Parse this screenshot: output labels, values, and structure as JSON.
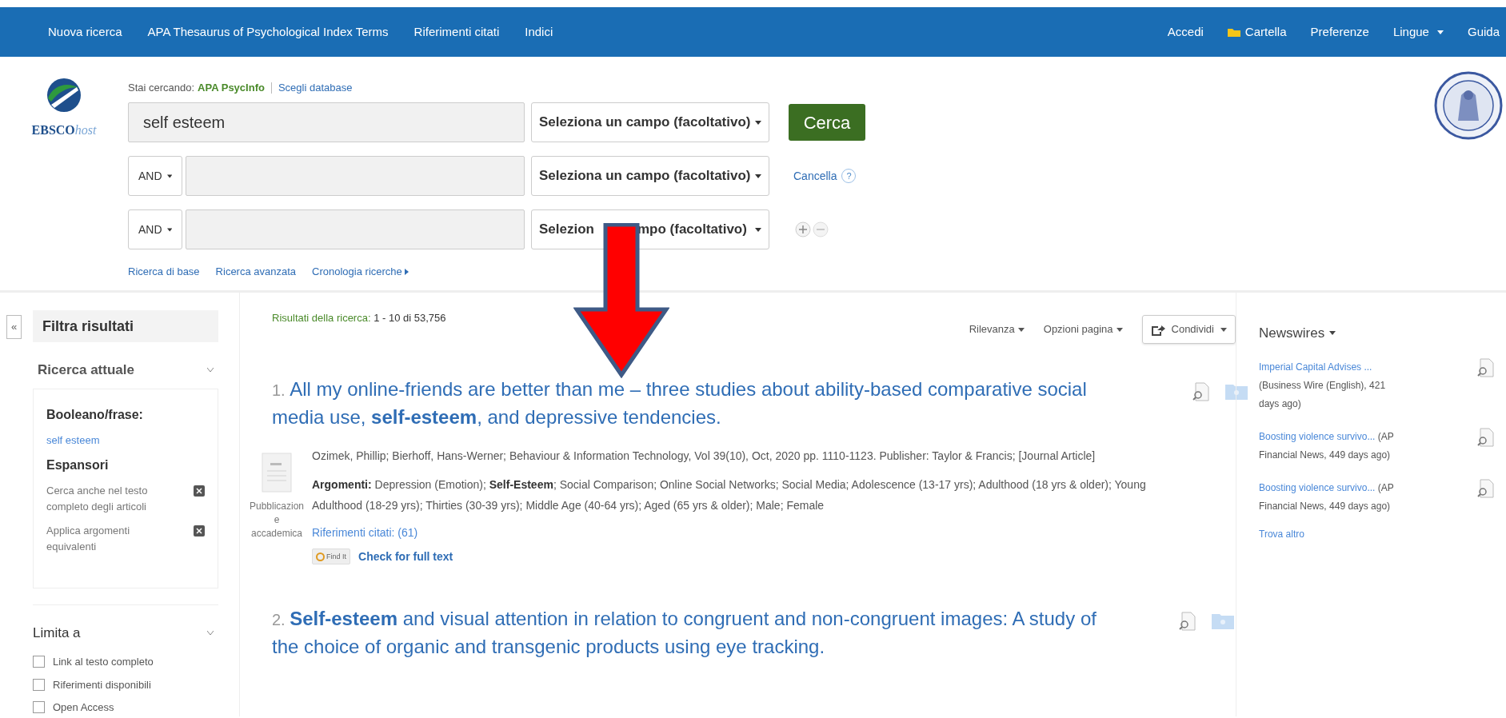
{
  "nav": {
    "left": [
      {
        "label": "Nuova ricerca",
        "kind": "link"
      },
      {
        "label": "APA Thesaurus of Psychological Index Terms",
        "kind": "link"
      },
      {
        "label": "Riferimenti citati",
        "kind": "link"
      },
      {
        "label": "Indici",
        "kind": "link"
      }
    ],
    "right": [
      {
        "label": "Accedi",
        "kind": "link"
      },
      {
        "label": "Cartella",
        "kind": "folder"
      },
      {
        "label": "Preferenze",
        "kind": "link"
      },
      {
        "label": "Lingue",
        "kind": "dropdown"
      },
      {
        "label": "Guida",
        "kind": "link"
      }
    ]
  },
  "logo": {
    "brand": "EBSCO",
    "suffix": "host"
  },
  "search": {
    "searching_label": "Stai cercando:",
    "database": "APA PsycInfo",
    "choose_database": "Scegli database",
    "rows": [
      {
        "value": "self esteem",
        "field": "Seleziona un campo (facoltativo)"
      },
      {
        "operator": "AND",
        "field": "Seleziona un campo (facoltativo)"
      },
      {
        "operator": "AND",
        "field_parts": [
          "Selezion",
          "mpo (facoltativo)"
        ]
      }
    ],
    "button": "Cerca",
    "clear": "Cancella",
    "help": "?",
    "links": [
      {
        "label": "Ricerca di base",
        "kind": "link"
      },
      {
        "label": "Ricerca avanzata",
        "kind": "link"
      },
      {
        "label": "Cronologia ricerche",
        "kind": "menu"
      }
    ]
  },
  "sidebar": {
    "collapse": "«",
    "title": "Filtra risultati",
    "current_title": "Ricerca attuale",
    "boolean_label": "Booleano/frase:",
    "boolean_value": "self esteem",
    "expanders_title": "Espansori",
    "expanders": [
      {
        "label": "Cerca anche nel testo completo degli articoli"
      },
      {
        "label": "Applica argomenti equivalenti"
      }
    ],
    "limit_title": "Limita a",
    "limits": [
      {
        "label": "Link al testo completo",
        "checked": false
      },
      {
        "label": "Riferimenti disponibili",
        "checked": false
      },
      {
        "label": "Open Access",
        "checked": false
      }
    ]
  },
  "results": {
    "summary_label": "Risultati della ricerca:",
    "summary": "1 - 10 di 53,756",
    "sort": "Rilevanza",
    "page_options": "Opzioni pagina",
    "share": "Condividi",
    "items": [
      {
        "number": "1.",
        "title": "All my online-friends are better than me – three studies about ability-based comparative social media use, **self-esteem**, and depressive tendencies.",
        "citation": "Ozimek, Phillip; Bierhoff, Hans-Werner; Behaviour & Information Technology, Vol 39(10), Oct, 2020 pp. 1110-1123. Publisher: Taylor & Francis; [Journal Article]",
        "subjects_label": "Argomenti:",
        "subjects": "Depression (Emotion); **Self-Esteem**; Social Comparison; Online Social Networks; Social Media; Adolescence (13-17 yrs); Adulthood (18 yrs & older); Young Adulthood (18-29 yrs); Thirties (30-39 yrs); Middle Age (40-64 yrs); Aged (65 yrs & older); Male; Female",
        "type": "Pubblicazione accademica",
        "refs": "Riferimenti citati: (61)",
        "find_it": "Find It",
        "full_text": "Check for full text"
      },
      {
        "number": "2.",
        "title": "**Self-esteem** and visual attention in relation to congruent and non-congruent images: A study of the choice of organic and transgenic products using eye tracking."
      }
    ]
  },
  "newswires": {
    "title": "Newswires",
    "items": [
      {
        "link": "Imperial Capital Advises ...",
        "source": "(Business Wire (English), 421 days ago)"
      },
      {
        "link": "Boosting violence survivo...",
        "source": "(AP Financial News, 449 days ago)"
      },
      {
        "link": "Boosting violence survivo...",
        "source": "(AP Financial News, 449 days ago)"
      }
    ],
    "more": "Trova altro"
  }
}
